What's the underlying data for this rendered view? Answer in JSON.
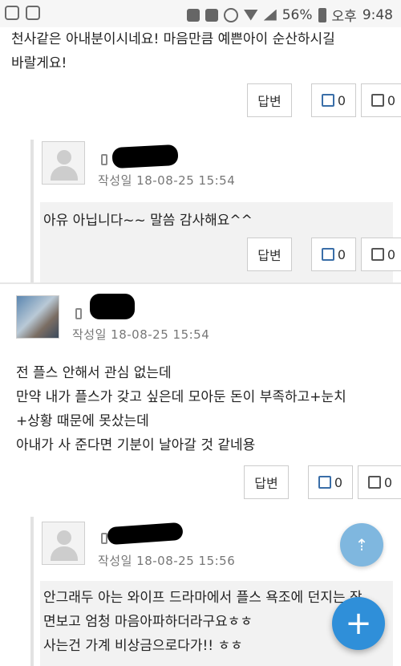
{
  "status": {
    "battery": "56%",
    "ampm": "오후",
    "time": "9:48"
  },
  "comment1": {
    "line1": "천사같은 아내분이시네요! 마음만큼 예쁜아이 순산하시길",
    "line2": "바랄게요!",
    "reply_label": "답변",
    "up": "0",
    "down": "0"
  },
  "reply1": {
    "meta": "작성일   18-08-25 15:54",
    "text": "아유 아닙니다~~ 말씀 감사해요^^",
    "reply_label": "답변",
    "up": "0",
    "down": "0"
  },
  "comment2": {
    "meta": "작성일   18-08-25 15:54",
    "line1": "전 플스 안해서 관심 없는데",
    "line2": "만약 내가 플스가 갖고 싶은데 모아둔 돈이 부족하고+눈치",
    "line3": "+상황 때문에 못샀는데",
    "line4": "아내가 사 준다면 기분이 날아갈 것 같네용",
    "reply_label": "답변",
    "up": "0",
    "down": "0"
  },
  "reply2": {
    "meta": "작성일   18-08-25 15:56",
    "line1": "안그래두 아는 와이프 드라마에서 플스 욕조에 던지는 장",
    "line2": "면보고 엄청 마음아파하더라구요ㅎㅎ",
    "line3": "사는건 가계 비상금으로다가!! ㅎㅎ"
  },
  "fab": {
    "scroll_top_glyph": "⇡",
    "add_glyph": "+"
  }
}
